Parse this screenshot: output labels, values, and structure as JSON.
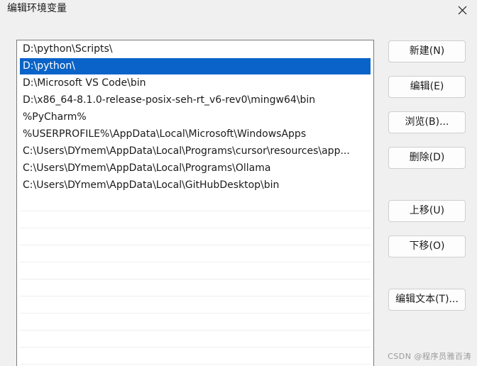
{
  "window": {
    "title": "编辑环境变量",
    "close_icon": "close-icon"
  },
  "list": {
    "items": [
      {
        "label": "D:\\python\\Scripts\\",
        "selected": false
      },
      {
        "label": "D:\\python\\",
        "selected": true
      },
      {
        "label": "D:\\Microsoft VS Code\\bin",
        "selected": false
      },
      {
        "label": "D:\\x86_64-8.1.0-release-posix-seh-rt_v6-rev0\\mingw64\\bin",
        "selected": false
      },
      {
        "label": "%PyCharm%",
        "selected": false
      },
      {
        "label": "%USERPROFILE%\\AppData\\Local\\Microsoft\\WindowsApps",
        "selected": false
      },
      {
        "label": "C:\\Users\\DYmem\\AppData\\Local\\Programs\\cursor\\resources\\app...",
        "selected": false
      },
      {
        "label": "C:\\Users\\DYmem\\AppData\\Local\\Programs\\Ollama",
        "selected": false
      },
      {
        "label": "C:\\Users\\DYmem\\AppData\\Local\\GitHubDesktop\\bin",
        "selected": false
      }
    ],
    "selection_color": "#0a63c8"
  },
  "buttons": {
    "new": "新建(N)",
    "edit": "编辑(E)",
    "browse": "浏览(B)...",
    "delete": "删除(D)",
    "move_up": "上移(U)",
    "move_down": "下移(O)",
    "edit_text": "编辑文本(T)..."
  },
  "watermark": "CSDN @程序员雅百涛"
}
